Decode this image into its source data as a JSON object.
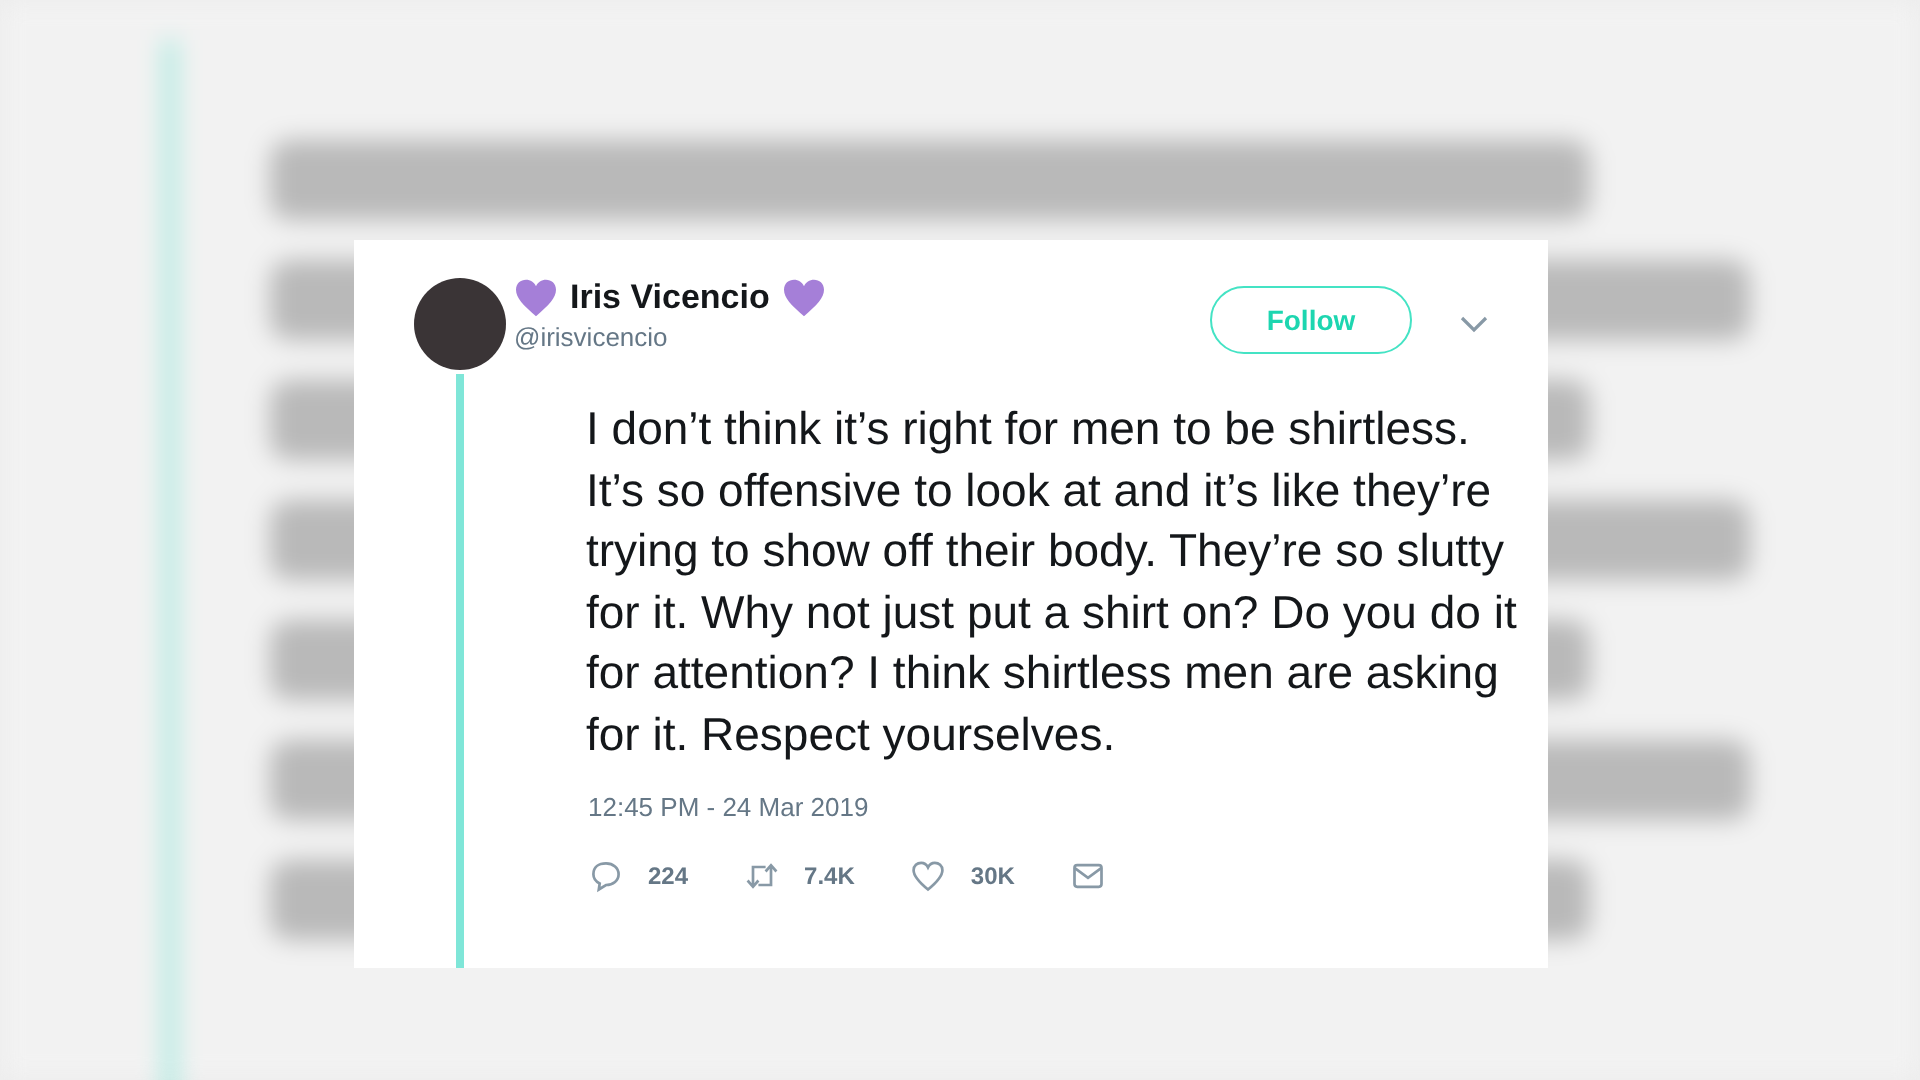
{
  "tweet": {
    "display_name": "Iris Vicencio",
    "handle": "@irisvicencio",
    "follow_button": "Follow",
    "text": "I don’t think it’s right for men to be shirtless. It’s so offensive to look at and it’s like they’re trying to show off their body. They’re so slutty for it. Why not just put a shirt on? Do you do it for attention? I think shirtless men are asking for it. Respect yourselves.",
    "timestamp": "12:45 PM - 24 Mar 2019",
    "actions": [
      {
        "kind": "reply",
        "count": "224"
      },
      {
        "kind": "retweet",
        "count": "7.4K"
      },
      {
        "kind": "like",
        "count": "30K"
      },
      {
        "kind": "message"
      }
    ]
  }
}
